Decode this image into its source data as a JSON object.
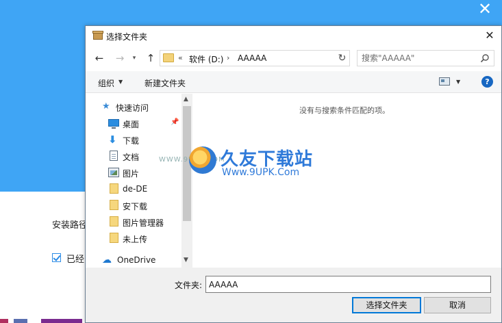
{
  "installer": {
    "close_glyph": "✕",
    "install_path_label": "安装路径",
    "checkbox_label": "已经"
  },
  "dialog": {
    "title": "选择文件夹",
    "close_glyph": "✕"
  },
  "nav": {
    "back_glyph": "←",
    "forward_glyph": "→",
    "recent_glyph": "▾",
    "up_glyph": "↑",
    "address_prefix": "«",
    "address_segments": [
      "软件 (D:)",
      "AAAAA"
    ],
    "address_separator": "›",
    "address_dropdown": "▾",
    "refresh_glyph": "↻",
    "search_placeholder": "搜索\"AAAAA\""
  },
  "toolbar": {
    "organize_label": "组织",
    "organize_arrow": "▼",
    "new_folder_label": "新建文件夹",
    "view_arrow": "▼",
    "help_glyph": "?"
  },
  "nav_pane": {
    "items": [
      {
        "label": "快速访问",
        "icon": "star-icon"
      },
      {
        "label": "桌面",
        "icon": "desktop-icon"
      },
      {
        "label": "下载",
        "icon": "download-icon"
      },
      {
        "label": "文档",
        "icon": "document-icon"
      },
      {
        "label": "图片",
        "icon": "picture-icon"
      },
      {
        "label": "de-DE",
        "icon": "folder-icon"
      },
      {
        "label": "安下载",
        "icon": "folder-icon"
      },
      {
        "label": "图片管理器",
        "icon": "folder-icon"
      },
      {
        "label": "未上传",
        "icon": "folder-icon"
      },
      {
        "label": "OneDrive",
        "icon": "cloud-icon"
      }
    ],
    "pin_glyph": "📌",
    "scroll_up": "▲",
    "scroll_down": "▼"
  },
  "content": {
    "empty_message": "没有与搜索条件匹配的项。"
  },
  "bottom": {
    "folder_label": "文件夹:",
    "folder_value": "AAAAA",
    "select_button": "选择文件夹",
    "cancel_button": "取消"
  },
  "watermark": {
    "title": "久友下载站",
    "url_small": "WWW.9UPK.COM",
    "url": "Www.9UPK.Com"
  }
}
